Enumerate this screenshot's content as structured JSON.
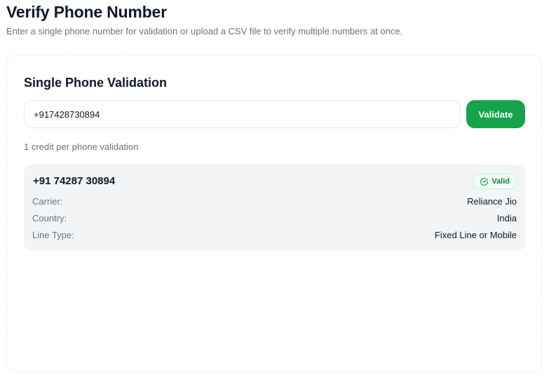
{
  "header": {
    "title": "Verify Phone Number",
    "subtitle": "Enter a single phone number for validation or upload a CSV file to verify multiple numbers at once."
  },
  "single_validation": {
    "title": "Single Phone Validation",
    "input_value": "+917428730894",
    "validate_label": "Validate",
    "credit_note": "1 credit per phone validation"
  },
  "result": {
    "formatted_number": "+91 74287 30894",
    "status_label": "Valid",
    "status_icon": "check-circle-icon",
    "details": [
      {
        "label": "Carrier:",
        "value": "Reliance Jio"
      },
      {
        "label": "Country:",
        "value": "India"
      },
      {
        "label": "Line Type:",
        "value": "Fixed Line or Mobile"
      }
    ]
  },
  "colors": {
    "accent": "#16a34a",
    "valid_text": "#15803d",
    "muted_text": "#6b7280",
    "panel_bg": "#f3f4f6"
  }
}
